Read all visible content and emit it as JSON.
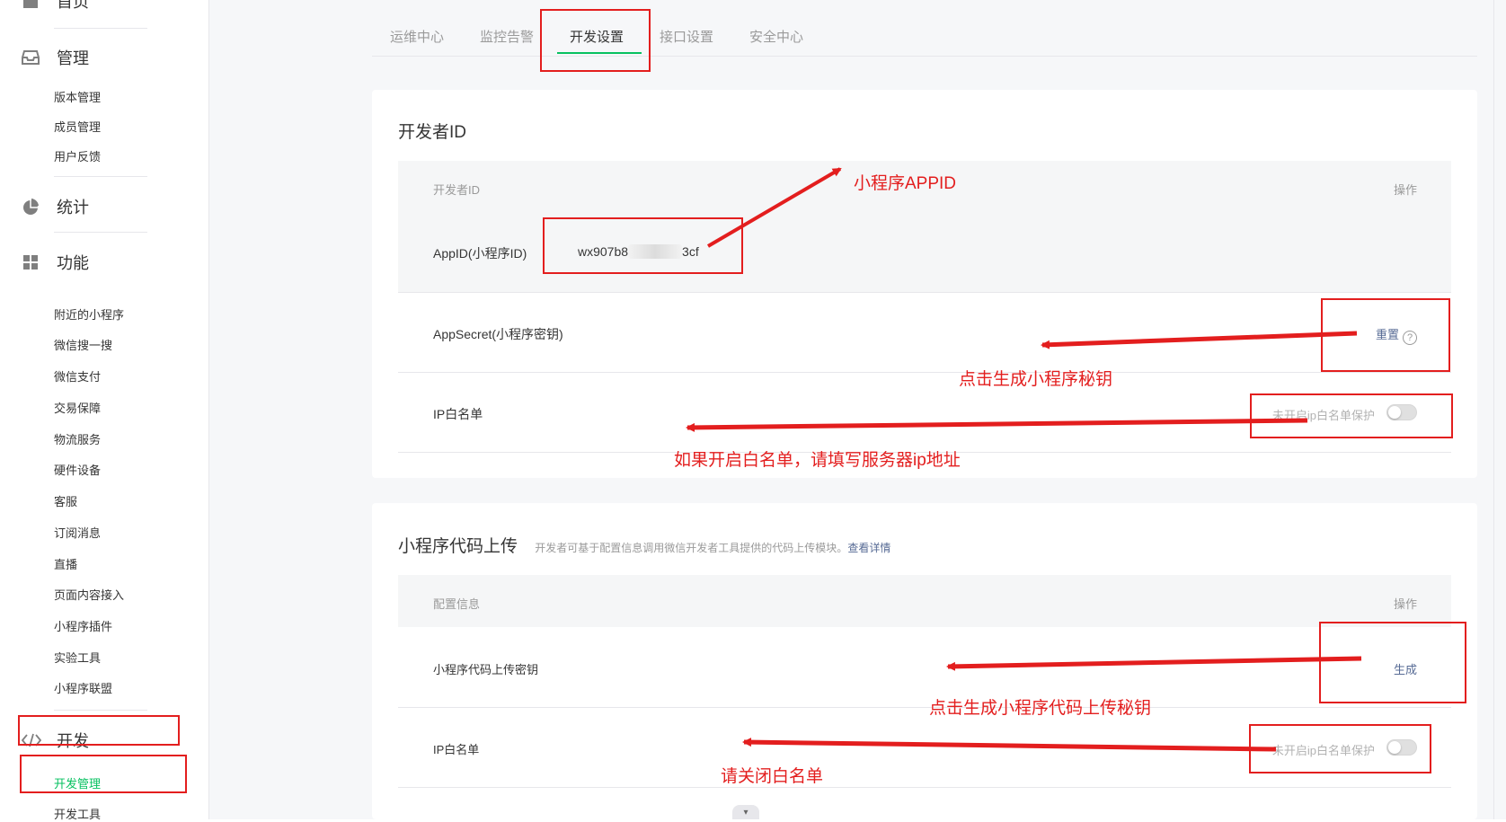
{
  "sidebar": {
    "home": "首页",
    "manage": {
      "title": "管理",
      "items": [
        "版本管理",
        "成员管理",
        "用户反馈"
      ]
    },
    "stats": {
      "title": "统计"
    },
    "features": {
      "title": "功能",
      "items": [
        "附近的小程序",
        "微信搜一搜",
        "微信支付",
        "交易保障",
        "物流服务",
        "硬件设备",
        "客服",
        "订阅消息",
        "直播",
        "页面内容接入",
        "小程序插件",
        "实验工具",
        "小程序联盟"
      ]
    },
    "dev": {
      "title": "开发",
      "items": [
        "开发管理",
        "开发工具"
      ]
    }
  },
  "tabs": [
    "运维中心",
    "监控告警",
    "开发设置",
    "接口设置",
    "安全中心"
  ],
  "dev_id_card": {
    "title": "开发者ID",
    "header_left": "开发者ID",
    "header_right": "操作",
    "appid_label": "AppID(小程序ID)",
    "appid_prefix": "wx907b8",
    "appid_suffix": "3cf",
    "appsecret_label": "AppSecret(小程序密钥)",
    "reset_link": "重置",
    "ip_label": "IP白名单",
    "ip_status": "未开启ip白名单保护"
  },
  "upload_card": {
    "title": "小程序代码上传",
    "desc": "开发者可基于配置信息调用微信开发者工具提供的代码上传模块。",
    "desc_link": "查看详情",
    "header_left": "配置信息",
    "header_right": "操作",
    "key_label": "小程序代码上传密钥",
    "generate_link": "生成",
    "ip_label": "IP白名单",
    "ip_status": "未开启ip白名单保护"
  },
  "annotations": {
    "appid_note": "小程序APPID",
    "secret_note": "点击生成小程序秘钥",
    "ip_note": "如果开启白名单，请填写服务器ip地址",
    "upload_key_note": "点击生成小程序代码上传秘钥",
    "close_ip_note": "请关闭白名单",
    "color": "#e31e1e"
  },
  "colors": {
    "accent": "#07c160",
    "link": "#576b95"
  },
  "icons": {
    "home": "home-icon",
    "manage": "inbox-icon",
    "stats": "pie-chart-icon",
    "features": "grid-icon",
    "dev": "code-icon",
    "help": "question-circle-icon",
    "scroll": "chevron-down-icon"
  }
}
